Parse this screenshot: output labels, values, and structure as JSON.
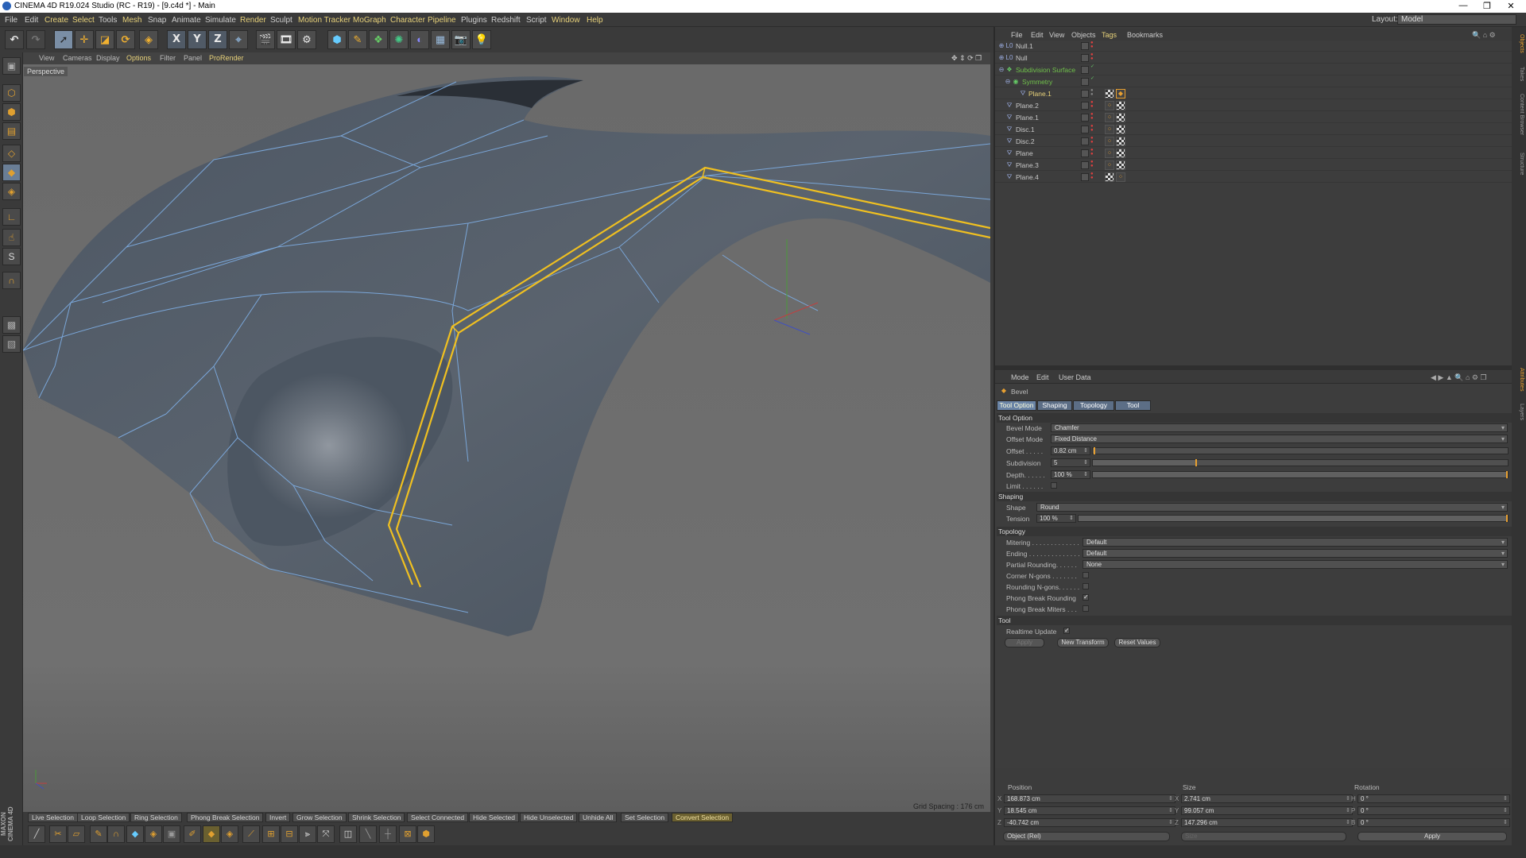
{
  "window": {
    "title": "CINEMA 4D R19.024 Studio (RC - R19) - [9.c4d *] - Main"
  },
  "menubar": {
    "items": [
      "File",
      "Edit",
      "Create",
      "Select",
      "Tools",
      "Mesh",
      "Snap",
      "Animate",
      "Simulate",
      "Render",
      "Sculpt",
      "Motion Tracker",
      "MoGraph",
      "Character",
      "Pipeline",
      "Plugins",
      "Redshift",
      "Script",
      "Window",
      "Help"
    ],
    "layout_label": "Layout:",
    "layout_value": "Model"
  },
  "viewport": {
    "menu": [
      "View",
      "Cameras",
      "Display",
      "Options",
      "Filter",
      "Panel",
      "ProRender"
    ],
    "label": "Perspective",
    "grid_spacing": "Grid Spacing : 176 cm"
  },
  "selection_toolbar": [
    "Live Selection",
    "Loop Selection",
    "Ring Selection",
    "Phong Break Selection",
    "Invert",
    "Grow Selection",
    "Shrink Selection",
    "Select Connected",
    "Hide Selected",
    "Hide Unselected",
    "Unhide All",
    "Set Selection",
    "Convert Selection"
  ],
  "branding": "MAXON CINEMA 4D",
  "object_manager": {
    "menu": [
      "File",
      "Edit",
      "View",
      "Objects",
      "Tags",
      "Bookmarks"
    ],
    "objects": [
      {
        "name": "Null.1"
      },
      {
        "name": "Null"
      },
      {
        "name": "Subdivision Surface"
      },
      {
        "name": "Symmetry"
      },
      {
        "name": "Plane.1"
      },
      {
        "name": "Plane.2"
      },
      {
        "name": "Plane.1"
      },
      {
        "name": "Disc.1"
      },
      {
        "name": "Disc.2"
      },
      {
        "name": "Plane"
      },
      {
        "name": "Plane.3"
      },
      {
        "name": "Plane.4"
      }
    ]
  },
  "attributes": {
    "menu": [
      "Mode",
      "Edit",
      "User Data"
    ],
    "tool_name": "Bevel",
    "tabs": [
      "Tool Option",
      "Shaping",
      "Topology",
      "Tool"
    ],
    "sections": {
      "tool_option": "Tool Option",
      "shaping": "Shaping",
      "topology": "Topology",
      "tool": "Tool"
    },
    "bevel_mode": {
      "label": "Bevel Mode",
      "value": "Chamfer"
    },
    "offset_mode": {
      "label": "Offset Mode",
      "value": "Fixed Distance"
    },
    "offset": {
      "label": "Offset . . . . .",
      "value": "0.82 cm",
      "level": 0.005
    },
    "subdivision": {
      "label": "Subdivision",
      "value": "5",
      "level": 0.25
    },
    "depth": {
      "label": "Depth. . . . . .",
      "value": "100 %",
      "level": 1.0
    },
    "limit": {
      "label": "Limit . . . . . ."
    },
    "shape": {
      "label": "Shape",
      "value": "Round"
    },
    "tension": {
      "label": "Tension",
      "value": "100 %",
      "level": 1.0
    },
    "mitering": {
      "label": "Mitering . . . . . . . . . . . . .",
      "value": "Default"
    },
    "ending": {
      "label": "Ending . . . . . . . . . . . . . .",
      "value": "Default"
    },
    "partial_rounding": {
      "label": "Partial Rounding. . . . . .",
      "value": "None"
    },
    "corner_ngons": {
      "label": "Corner N-gons . . . . . . ."
    },
    "rounding_ngons": {
      "label": "Rounding N-gons. . . . . ."
    },
    "phong_break_rounding": {
      "label": "Phong Break Rounding"
    },
    "phong_break_miters": {
      "label": "Phong Break Miters . . ."
    },
    "realtime_update": {
      "label": "Realtime Update"
    },
    "buttons": {
      "apply": "Apply",
      "new_transform": "New Transform",
      "reset_values": "Reset Values"
    }
  },
  "coordinates": {
    "headers": {
      "position": "Position",
      "size": "Size",
      "rotation": "Rotation"
    },
    "position": {
      "x": "168.873 cm",
      "y": "18.545 cm",
      "z": "-40.742 cm"
    },
    "size": {
      "x": "2.741 cm",
      "y": "99.057 cm",
      "z": "147.296 cm"
    },
    "rotation": {
      "h": "0 °",
      "p": "0 °",
      "b": "0 °"
    },
    "axis_labels": {
      "x": "X",
      "y": "Y",
      "z": "Z",
      "h": "H",
      "p": "P",
      "b": "B"
    },
    "mode": "Object (Rel)",
    "size_mode": "Size",
    "apply": "Apply"
  },
  "side_tabs": [
    "Objects",
    "Takes",
    "Content Browser",
    "Structure",
    "Attributes",
    "Layers"
  ],
  "colors": {
    "selection_edge": "#f0c020",
    "wire": "#7aa6d8",
    "accent": "#e8a030"
  }
}
